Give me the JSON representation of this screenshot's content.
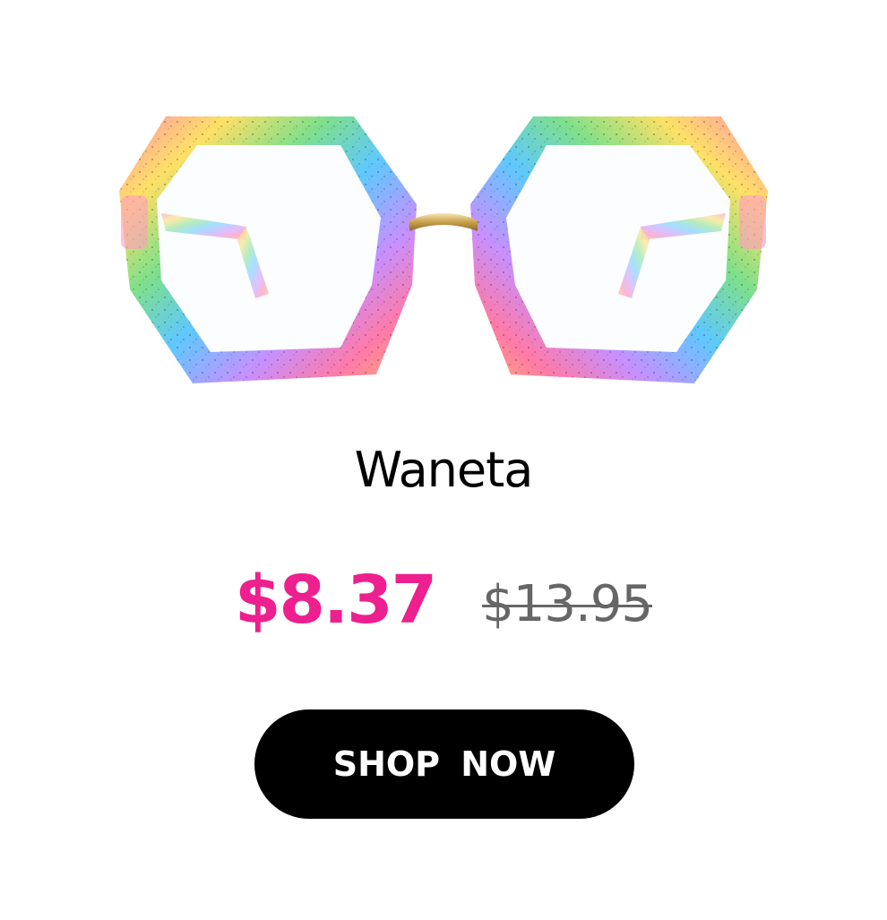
{
  "product": {
    "image_icon": "rainbow-glasses-image",
    "name": "Waneta",
    "sale_price": "$8.37",
    "original_price": "$13.95",
    "cta_label": "SHOP  NOW"
  },
  "colors": {
    "sale_price": "#ee1f8e",
    "original_price": "#666666",
    "button_bg": "#000000",
    "button_text": "#ffffff"
  }
}
